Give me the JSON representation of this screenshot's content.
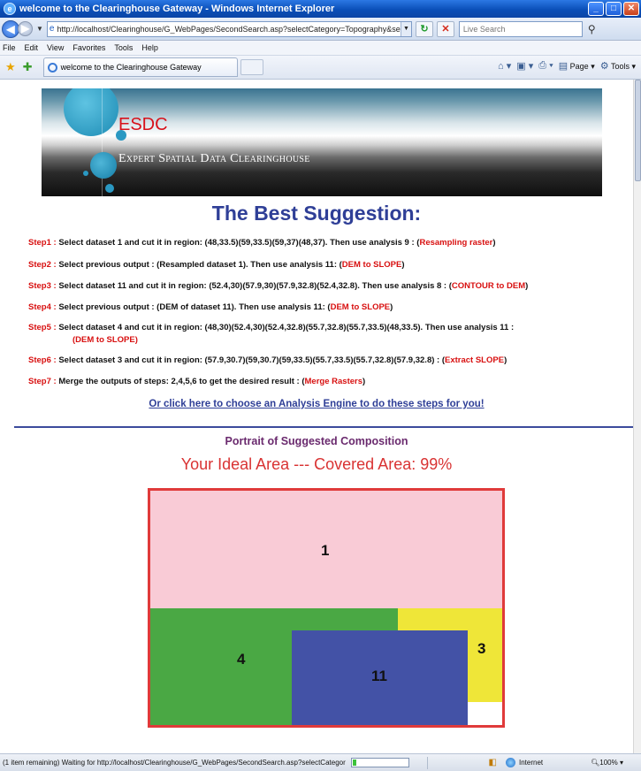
{
  "window": {
    "title": "welcome to the Clearinghouse Gateway - Windows Internet Explorer",
    "controls": [
      "_",
      "□",
      "✕"
    ]
  },
  "address_bar": {
    "url": "http://localhost/Clearinghouse/G_WebPages/SecondSearch.asp?selectCategory=Topography&selectType=IMAGE_slope&se",
    "search_placeholder": "Live Search"
  },
  "menu": [
    "File",
    "Edit",
    "View",
    "Favorites",
    "Tools",
    "Help"
  ],
  "tab": {
    "label": "welcome to the Clearinghouse Gateway"
  },
  "command_bar": {
    "page_label": "Page",
    "tools_label": "Tools"
  },
  "banner": {
    "brand": "ESDC",
    "subtitle": "Expert Spatial Data Clearinghouse"
  },
  "main": {
    "heading": "The Best Suggestion:",
    "steps": [
      {
        "label": "Step1 :",
        "text": " Select dataset 1 and cut it in region: (48,33.5)(59,33.5)(59,37)(48,37). Then use analysis 9 : (",
        "analysis": "Resampling raster",
        "close": ")"
      },
      {
        "label": "Step2 :",
        "text": " Select previous output : (Resampled dataset 1). Then use analysis 11: (",
        "analysis": "DEM to SLOPE",
        "close": ")"
      },
      {
        "label": "Step3 :",
        "text": " Select dataset 11 and cut it in region: (52.4,30)(57.9,30)(57.9,32.8)(52.4,32.8). Then use analysis 8 : (",
        "analysis": "CONTOUR to DEM",
        "close": ")"
      },
      {
        "label": "Step4 :",
        "text": " Select previous output : (DEM of dataset 11). Then use analysis 11: (",
        "analysis": "DEM to SLOPE",
        "close": ")"
      },
      {
        "label": "Step5 :",
        "text": " Select dataset 4 and cut it in region: (48,30)(52.4,30)(52.4,32.8)(55.7,32.8)(55.7,33.5)(48,33.5). Then use analysis 11 :",
        "analysis": "(DEM to SLOPE)",
        "close": ""
      },
      {
        "label": "Step6 :",
        "text": " Select dataset 3 and cut it in region: (57.9,30.7)(59,30.7)(59,33.5)(55.7,33.5)(55.7,32.8)(57.9,32.8) : (",
        "analysis": "Extract SLOPE",
        "close": ")"
      },
      {
        "label": "Step7 :",
        "text": " Merge the outputs of steps: 2,4,5,6 to get the desired result : (",
        "analysis": "Merge Rasters",
        "close": ")"
      }
    ],
    "engine_link": "Or click here to choose an Analysis Engine to do these steps for you!",
    "portrait_title": "Portrait of Suggested Composition",
    "coverage_text": "Your Ideal Area --- Covered Area: 99%",
    "regions": [
      {
        "id": "1",
        "color": "#f9cbd6"
      },
      {
        "id": "4",
        "color": "#4aa844"
      },
      {
        "id": "3",
        "color": "#efe638"
      },
      {
        "id": "11",
        "color": "#4352a6"
      }
    ]
  },
  "status_bar": {
    "message": "(1 item remaining) Waiting for http://localhost/Clearinghouse/G_WebPages/SecondSearch.asp?selectCategor",
    "progress": 0.06,
    "zone": "Internet",
    "zoom": "100%"
  }
}
